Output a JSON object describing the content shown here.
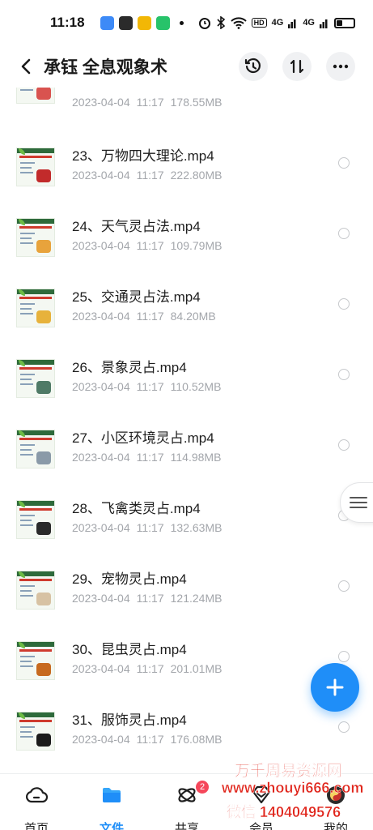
{
  "status_bar": {
    "time": "11:18",
    "app_icons": [
      {
        "name": "app-icon-1",
        "color": "#3d8af7"
      },
      {
        "name": "wechat-icon",
        "color": "#2b2b2b"
      },
      {
        "name": "app-icon-3",
        "color": "#f2b705"
      },
      {
        "name": "app-icon-4",
        "color": "#27c36a"
      }
    ],
    "signal_labels": [
      "HD",
      "4G",
      "4G"
    ],
    "battery_level": 0.3
  },
  "header": {
    "title": "承钰 全息观象术"
  },
  "files": [
    {
      "name": "",
      "date": "2023-04-04",
      "time": "11:17",
      "size": "178.55MB",
      "pic": "#d9534f"
    },
    {
      "name": "23、万物四大理论.mp4",
      "date": "2023-04-04",
      "time": "11:17",
      "size": "222.80MB",
      "pic": "#c22b2b"
    },
    {
      "name": "24、天气灵占法.mp4",
      "date": "2023-04-04",
      "time": "11:17",
      "size": "109.79MB",
      "pic": "#e8a33c"
    },
    {
      "name": "25、交通灵占法.mp4",
      "date": "2023-04-04",
      "time": "11:17",
      "size": "84.20MB",
      "pic": "#e7b23b"
    },
    {
      "name": "26、景象灵占.mp4",
      "date": "2023-04-04",
      "time": "11:17",
      "size": "110.52MB",
      "pic": "#4f7a66"
    },
    {
      "name": "27、小区环境灵占.mp4",
      "date": "2023-04-04",
      "time": "11:17",
      "size": "114.98MB",
      "pic": "#8a9aa8"
    },
    {
      "name": "28、飞禽类灵占.mp4",
      "date": "2023-04-04",
      "time": "11:17",
      "size": "132.63MB",
      "pic": "#2a2a2a"
    },
    {
      "name": "29、宠物灵占.mp4",
      "date": "2023-04-04",
      "time": "11:17",
      "size": "121.24MB",
      "pic": "#d7c2a3"
    },
    {
      "name": "30、昆虫灵占.mp4",
      "date": "2023-04-04",
      "time": "11:17",
      "size": "201.01MB",
      "pic": "#c76a1f"
    },
    {
      "name": "31、服饰灵占.mp4",
      "date": "2023-04-04",
      "time": "11:17",
      "size": "176.08MB",
      "pic": "#1b1b1b"
    }
  ],
  "bottom_nav": {
    "items": [
      {
        "label": "首页",
        "icon": "cloud-home-icon"
      },
      {
        "label": "文件",
        "icon": "folder-icon"
      },
      {
        "label": "共享",
        "icon": "share-orbit-icon",
        "badge": "2"
      },
      {
        "label": "会员",
        "icon": "diamond-icon"
      },
      {
        "label": "我的",
        "icon": "profile-icon"
      }
    ],
    "active_index": 1
  },
  "watermark": {
    "line1": "万千周易资源网",
    "line2": "www.zhouyi666.com",
    "line3": "微信 1404049576"
  },
  "colors": {
    "accent": "#1f8ef8",
    "badge": "#f5475b",
    "watermark": "#e0241a"
  }
}
